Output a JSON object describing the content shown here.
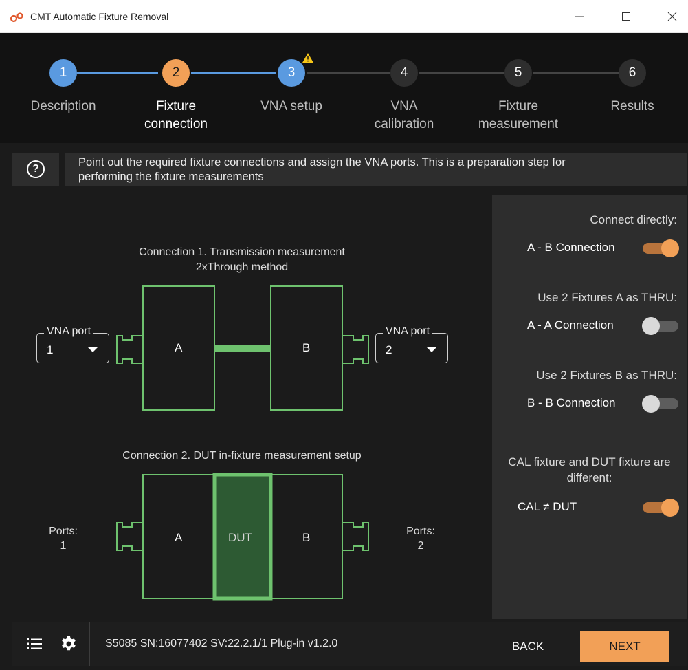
{
  "window": {
    "title": "CMT Automatic Fixture Removal",
    "logo_icon": "cmt-logo-icon",
    "controls": [
      "minimize-icon",
      "maximize-icon",
      "close-icon"
    ]
  },
  "stepper": {
    "current_step": 2,
    "steps": [
      {
        "number": "1",
        "label_line1": "Description",
        "label_line2": "",
        "state": "completed"
      },
      {
        "number": "2",
        "label_line1": "Fixture",
        "label_line2": "connection",
        "state": "active"
      },
      {
        "number": "3",
        "label_line1": "VNA setup",
        "label_line2": "",
        "state": "warning",
        "badge_icon": "warning-icon"
      },
      {
        "number": "4",
        "label_line1": "VNA",
        "label_line2": "calibration",
        "state": "pending"
      },
      {
        "number": "5",
        "label_line1": "Fixture",
        "label_line2": "measurement",
        "state": "pending"
      },
      {
        "number": "6",
        "label_line1": "Results",
        "label_line2": "",
        "state": "pending"
      }
    ]
  },
  "description": {
    "help_icon": "question-circle-icon",
    "line1": "Point out the required fixture connections and assign the VNA ports. This is a preparation step for",
    "line2": "performing the fixture measurements"
  },
  "connection1": {
    "title_line1": "Connection 1. Transmission measurement",
    "title_line2": "2xThrough method",
    "fixture_a": "A",
    "fixture_b": "B",
    "left_port": {
      "legend": "VNA port",
      "value": "1"
    },
    "right_port": {
      "legend": "VNA port",
      "value": "2"
    }
  },
  "connection2": {
    "title": "Connection 2. DUT in-fixture measurement setup",
    "fixture_a": "A",
    "dut": "DUT",
    "fixture_b": "B",
    "left_ports_label": "Ports:",
    "left_ports_value": "1",
    "right_ports_label": "Ports:",
    "right_ports_value": "2"
  },
  "options": {
    "connect_directly_heading": "Connect directly:",
    "ab_label": "A - B Connection",
    "ab_on": true,
    "aa_heading": "Use 2 Fixtures A as THRU:",
    "aa_label": "A - A Connection",
    "aa_on": false,
    "bb_heading": "Use 2 Fixtures B as THRU:",
    "bb_label": "B - B Connection",
    "bb_on": false,
    "cal_heading_line1": "CAL fixture and DUT fixture are",
    "cal_heading_line2": "different:",
    "cal_label": "CAL ≠ DUT",
    "cal_on": true
  },
  "footer": {
    "menu_icon": "list-icon",
    "settings_icon": "gear-icon",
    "device_info": "S5085 SN:16077402 SV:22.2.1/1 Plug-in v1.2.0",
    "back_label": "BACK",
    "next_label": "NEXT"
  },
  "colors": {
    "completed": "#5a9ae0",
    "active": "#f2a057",
    "pending": "#2e2e2e",
    "fixture_outline": "#6ec26e",
    "dut_fill": "#2d5a33",
    "accent": "#f2a057",
    "toggle_on_track": "#b9743c",
    "toggle_off_knob": "#d9d9d9"
  }
}
